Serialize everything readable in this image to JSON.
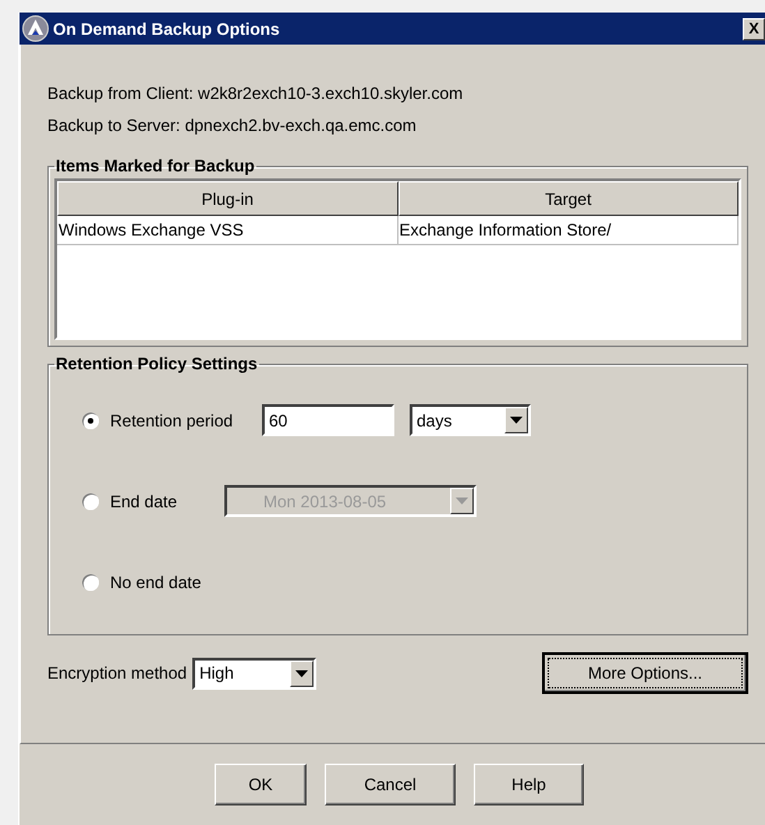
{
  "window": {
    "title": "On Demand Backup Options",
    "close": "X"
  },
  "info_lines": [
    "Backup from Client: w2k8r2exch10-3.exch10.skyler.com",
    "Backup to Server: dpnexch2.bv-exch.qa.emc.com"
  ],
  "items_group": {
    "title": "Items Marked for Backup",
    "columns": [
      "Plug-in",
      "Target"
    ],
    "rows": [
      [
        "Windows Exchange VSS",
        "Exchange Information Store/"
      ]
    ]
  },
  "retention_group": {
    "title": "Retention Policy Settings",
    "options": [
      {
        "kind": "period",
        "label": "Retention period",
        "selected": true,
        "value": "60",
        "unit": "days"
      },
      {
        "kind": "date",
        "label": "End date",
        "selected": false,
        "value": "Mon 2013-08-05",
        "disabled": true
      },
      {
        "kind": "none",
        "label": "No end date",
        "selected": false
      }
    ]
  },
  "encryption": {
    "label": "Encryption method",
    "value": "High"
  },
  "more_options_button": "More Options...",
  "buttons": [
    "OK",
    "Cancel",
    "Help"
  ]
}
